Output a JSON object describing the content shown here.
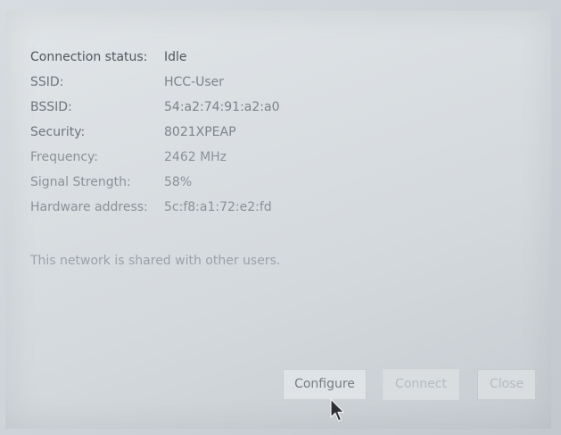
{
  "details": [
    {
      "key": "Connection status:",
      "value": "Idle"
    },
    {
      "key": "SSID:",
      "value": "HCC-User"
    },
    {
      "key": "BSSID:",
      "value": "54:a2:74:91:a2:a0"
    },
    {
      "key": "Security:",
      "value": "8021XPEAP"
    },
    {
      "key": "Frequency:",
      "value": "2462 MHz"
    },
    {
      "key": "Signal Strength:",
      "value": "58%"
    },
    {
      "key": "Hardware address:",
      "value": "5c:f8:a1:72:e2:fd"
    }
  ],
  "message": "This network is shared with other users.",
  "buttons": {
    "configure": "Configure",
    "connect": "Connect",
    "close": "Close"
  }
}
